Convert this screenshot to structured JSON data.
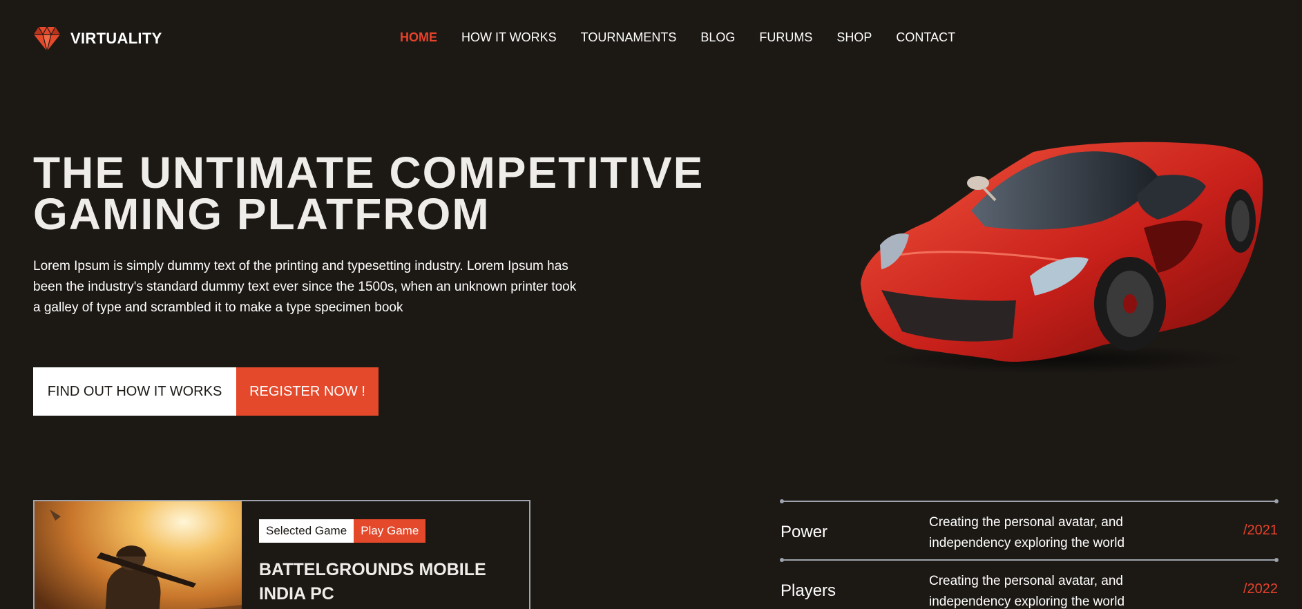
{
  "brand": {
    "name": "VIRTUALITY",
    "logo_icon": "diamond-icon",
    "accent_color": "#e7422a"
  },
  "nav": {
    "items": [
      {
        "label": "HOME",
        "active": true
      },
      {
        "label": "HOW IT WORKS"
      },
      {
        "label": "TOURNAMENTS"
      },
      {
        "label": "BLOG"
      },
      {
        "label": "FURUMS"
      },
      {
        "label": "SHOP"
      },
      {
        "label": "CONTACT"
      }
    ]
  },
  "hero": {
    "title_line1": "THE UNTIMATE COMPETITIVE",
    "title_line2": "GAMING PLATFROM",
    "description": "Lorem Ipsum is simply dummy text of the printing and typesetting industry. Lorem Ipsum has been the industry's standard dummy text ever since the 1500s, when an unknown printer took a galley of type and scrambled it to make a type specimen book",
    "primary_button": "FIND OUT HOW IT WORKS",
    "secondary_button": "REGISTER NOW !",
    "image": "red-sports-car-image"
  },
  "game_card": {
    "tag_selected": "Selected Game",
    "tag_play": "Play Game",
    "title": "BATTELGROUNDS MOBILE INDIA PC",
    "image": "soldier-with-rifle-image"
  },
  "stats": [
    {
      "name": "Power",
      "description": "Creating the personal avatar, and independency exploring the world",
      "year": "/2021"
    },
    {
      "name": "Players",
      "description": "Creating the personal avatar, and independency exploring the world",
      "year": "/2022"
    }
  ],
  "colors": {
    "background": "#1c1915",
    "accent": "#e4492b",
    "text": "#ffffff"
  }
}
